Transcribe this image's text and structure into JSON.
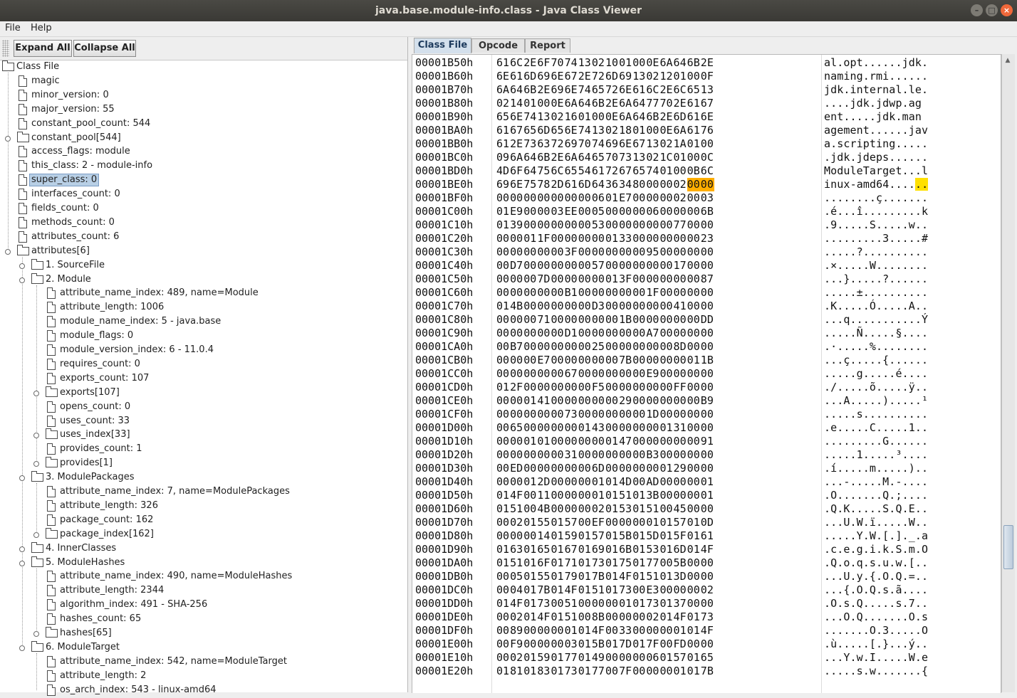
{
  "window": {
    "title": "java.base.module-info.class - Java Class Viewer"
  },
  "menu": {
    "file": "File",
    "help": "Help"
  },
  "toolbar": {
    "expand_all": "Expand All",
    "collapse_all": "Collapse All"
  },
  "tree": {
    "nodes": [
      {
        "label": "Class File",
        "type": "folder",
        "expanded": true,
        "level": 0
      },
      {
        "label": "magic",
        "type": "file",
        "level": 1
      },
      {
        "label": "minor_version: 0",
        "type": "file",
        "level": 1
      },
      {
        "label": "major_version: 55",
        "type": "file",
        "level": 1
      },
      {
        "label": "constant_pool_count: 544",
        "type": "file",
        "level": 1
      },
      {
        "label": "constant_pool[544]",
        "type": "folder",
        "expanded": false,
        "level": 1
      },
      {
        "label": "access_flags: module",
        "type": "file",
        "level": 1
      },
      {
        "label": "this_class: 2 - module-info",
        "type": "file",
        "level": 1
      },
      {
        "label": "super_class: 0",
        "type": "file",
        "level": 1,
        "selected": true
      },
      {
        "label": "interfaces_count: 0",
        "type": "file",
        "level": 1
      },
      {
        "label": "fields_count: 0",
        "type": "file",
        "level": 1
      },
      {
        "label": "methods_count: 0",
        "type": "file",
        "level": 1
      },
      {
        "label": "attributes_count: 6",
        "type": "file",
        "level": 1
      },
      {
        "label": "attributes[6]",
        "type": "folder",
        "expanded": true,
        "level": 1
      },
      {
        "label": "1. SourceFile",
        "type": "folder",
        "expanded": false,
        "level": 2
      },
      {
        "label": "2. Module",
        "type": "folder",
        "expanded": true,
        "level": 2
      },
      {
        "label": "attribute_name_index: 489, name=Module",
        "type": "file",
        "level": 3
      },
      {
        "label": "attribute_length: 1006",
        "type": "file",
        "level": 3
      },
      {
        "label": "module_name_index: 5 - java.base",
        "type": "file",
        "level": 3
      },
      {
        "label": "module_flags: 0",
        "type": "file",
        "level": 3
      },
      {
        "label": "module_version_index: 6 - 11.0.4",
        "type": "file",
        "level": 3
      },
      {
        "label": "requires_count: 0",
        "type": "file",
        "level": 3
      },
      {
        "label": "exports_count: 107",
        "type": "file",
        "level": 3
      },
      {
        "label": "exports[107]",
        "type": "folder",
        "expanded": false,
        "level": 3
      },
      {
        "label": "opens_count: 0",
        "type": "file",
        "level": 3
      },
      {
        "label": "uses_count: 33",
        "type": "file",
        "level": 3
      },
      {
        "label": "uses_index[33]",
        "type": "folder",
        "expanded": false,
        "level": 3
      },
      {
        "label": "provides_count: 1",
        "type": "file",
        "level": 3
      },
      {
        "label": "provides[1]",
        "type": "folder",
        "expanded": false,
        "level": 3
      },
      {
        "label": "3. ModulePackages",
        "type": "folder",
        "expanded": true,
        "level": 2
      },
      {
        "label": "attribute_name_index: 7, name=ModulePackages",
        "type": "file",
        "level": 3
      },
      {
        "label": "attribute_length: 326",
        "type": "file",
        "level": 3
      },
      {
        "label": "package_count: 162",
        "type": "file",
        "level": 3
      },
      {
        "label": "package_index[162]",
        "type": "folder",
        "expanded": false,
        "level": 3
      },
      {
        "label": "4. InnerClasses",
        "type": "folder",
        "expanded": false,
        "level": 2
      },
      {
        "label": "5. ModuleHashes",
        "type": "folder",
        "expanded": true,
        "level": 2
      },
      {
        "label": "attribute_name_index: 490, name=ModuleHashes",
        "type": "file",
        "level": 3
      },
      {
        "label": "attribute_length: 2344",
        "type": "file",
        "level": 3
      },
      {
        "label": "algorithm_index: 491 - SHA-256",
        "type": "file",
        "level": 3
      },
      {
        "label": "hashes_count: 65",
        "type": "file",
        "level": 3
      },
      {
        "label": "hashes[65]",
        "type": "folder",
        "expanded": false,
        "level": 3
      },
      {
        "label": "6. ModuleTarget",
        "type": "folder",
        "expanded": true,
        "level": 2
      },
      {
        "label": "attribute_name_index: 542, name=ModuleTarget",
        "type": "file",
        "level": 3
      },
      {
        "label": "attribute_length: 2",
        "type": "file",
        "level": 3
      },
      {
        "label": "os_arch_index: 543 - linux-amd64",
        "type": "file",
        "level": 3
      }
    ]
  },
  "tabs": [
    {
      "label": "Class File",
      "active": true
    },
    {
      "label": "Opcode",
      "active": false
    },
    {
      "label": "Report",
      "active": false
    }
  ],
  "hex": {
    "highlight": {
      "row": 9,
      "bytes": [
        14,
        15
      ]
    },
    "rows": [
      {
        "addr": "00001B50h",
        "bytes": "61 6C 2E 6F 70 74 13 02 10 01 00 0E 6A 64 6B 2E",
        "ascii": "al.opt......jdk."
      },
      {
        "addr": "00001B60h",
        "bytes": "6E 61 6D 69 6E 67 2E 72 6D 69 13 02 12 01 00 0F",
        "ascii": "naming.rmi......"
      },
      {
        "addr": "00001B70h",
        "bytes": "6A 64 6B 2E 69 6E 74 65 72 6E 61 6C 2E 6C 65 13",
        "ascii": "jdk.internal.le."
      },
      {
        "addr": "00001B80h",
        "bytes": "02 14 01 00 0E 6A 64 6B 2E 6A 64 77 70 2E 61 67",
        "ascii": "....jdk.jdwp.ag"
      },
      {
        "addr": "00001B90h",
        "bytes": "65 6E 74 13 02 16 01 00 0E 6A 64 6B 2E 6D 61 6E",
        "ascii": "ent.....jdk.man"
      },
      {
        "addr": "00001BA0h",
        "bytes": "61 67 65 6D 65 6E 74 13 02 18 01 00 0E 6A 61 76",
        "ascii": "agement......jav"
      },
      {
        "addr": "00001BB0h",
        "bytes": "61 2E 73 63 72 69 70 74 69 6E 67 13 02 1A 01 00",
        "ascii": "a.scripting....."
      },
      {
        "addr": "00001BC0h",
        "bytes": "09 6A 64 6B 2E 6A 64 65 70 73 13 02 1C 01 00 0C",
        "ascii": ".jdk.jdeps......"
      },
      {
        "addr": "00001BD0h",
        "bytes": "4D 6F 64 75 6C 65 54 61 72 67 65 74 01 00 0B 6C",
        "ascii": "ModuleTarget...l"
      },
      {
        "addr": "00001BE0h",
        "bytes": "69 6E 75 78 2D 61 6D 64 36 34 80 00 00 02 00 00",
        "ascii": "inux-amd64......"
      },
      {
        "addr": "00001BF0h",
        "bytes": "00 00 00 00 00 00 00 06 01 E7 00 00 00 02 00 03",
        "ascii": "........ç......."
      },
      {
        "addr": "00001C00h",
        "bytes": "01 E9 00 00 03 EE 00 05 00 00 00 06 00 00 00 6B",
        "ascii": ".é...î.........k"
      },
      {
        "addr": "00001C10h",
        "bytes": "01 39 00 00 00 00 00 53 00 00 00 00 00 77 00 00",
        "ascii": ".9.....S.....w.."
      },
      {
        "addr": "00001C20h",
        "bytes": "00 00 01 1F 00 00 00 00 01 33 00 00 00 00 00 23",
        "ascii": ".........3.....#"
      },
      {
        "addr": "00001C30h",
        "bytes": "00 00 00 00 00 3F 00 00 00 00 00 95 00 00 00 00",
        "ascii": ".....?.........."
      },
      {
        "addr": "00001C40h",
        "bytes": "00 D7 00 00 00 00 00 57 00 00 00 00 00 17 00 00",
        "ascii": ".×.....W........"
      },
      {
        "addr": "00001C50h",
        "bytes": "00 00 00 7D 00 00 00 00 01 3F 00 00 00 00 00 87",
        "ascii": "...}.....?......"
      },
      {
        "addr": "00001C60h",
        "bytes": "00 00 00 00 00 B1 00 00 00 00 00 1F 00 00 00 00",
        "ascii": ".....±.........."
      },
      {
        "addr": "00001C70h",
        "bytes": "01 4B 00 00 00 00 00 D3 00 00 00 00 00 41 00 00",
        "ascii": ".K.....Ó.....A.."
      },
      {
        "addr": "00001C80h",
        "bytes": "00 00 00 71 00 00 00 00 00 1B 00 00 00 00 00 DD",
        "ascii": "...q...........Ý"
      },
      {
        "addr": "00001C90h",
        "bytes": "00 00 00 00 00 D1 00 00 00 00 00 A7 00 00 00 00",
        "ascii": ".....Ñ.....§...."
      },
      {
        "addr": "00001CA0h",
        "bytes": "00 B7 00 00 00 00 00 25 00 00 00 00 00 8D 00 00",
        "ascii": ".·.....%........"
      },
      {
        "addr": "00001CB0h",
        "bytes": "00 00 00 E7 00 00 00 00 00 7B 00 00 00 00 01 1B",
        "ascii": "...ç.....{......"
      },
      {
        "addr": "00001CC0h",
        "bytes": "00 00 00 00 00 67 00 00 00 00 00 E9 00 00 00 00",
        "ascii": ".....g.....é...."
      },
      {
        "addr": "00001CD0h",
        "bytes": "01 2F 00 00 00 00 00 F5 00 00 00 00 00 FF 00 00",
        "ascii": "./.....õ.....ÿ.."
      },
      {
        "addr": "00001CE0h",
        "bytes": "00 00 01 41 00 00 00 00 00 29 00 00 00 00 00 B9",
        "ascii": "...A.....).....¹"
      },
      {
        "addr": "00001CF0h",
        "bytes": "00 00 00 00 00 73 00 00 00 00 00 1D 00 00 00 00",
        "ascii": ".....s.........."
      },
      {
        "addr": "00001D00h",
        "bytes": "00 65 00 00 00 00 01 43 00 00 00 00 01 31 00 00",
        "ascii": ".e.....C.....1.."
      },
      {
        "addr": "00001D10h",
        "bytes": "00 00 01 01 00 00 00 00 01 47 00 00 00 00 00 91",
        "ascii": ".........G......"
      },
      {
        "addr": "00001D20h",
        "bytes": "00 00 00 00 00 31 00 00 00 00 00 B3 00 00 00 00",
        "ascii": ".....1.....³...."
      },
      {
        "addr": "00001D30h",
        "bytes": "00 ED 00 00 00 00 00 6D 00 00 00 00 01 29 00 00",
        "ascii": ".í.....m.....).."
      },
      {
        "addr": "00001D40h",
        "bytes": "00 00 01 2D 00 00 00 01 01 4D 00 AD 00 00 00 01",
        "ascii": "...-.....M.-...."
      },
      {
        "addr": "00001D50h",
        "bytes": "01 4F 00 11 00 00 00 01 01 51 01 3B 00 00 00 01",
        "ascii": ".O.......Q.;...."
      },
      {
        "addr": "00001D60h",
        "bytes": "01 51 00 4B 00 00 00 02 01 53 01 51 00 45 00 00",
        "ascii": ".Q.K.....S.Q.E.."
      },
      {
        "addr": "00001D70h",
        "bytes": "00 02 01 55 01 57 00 EF 00 00 00 01 01 57 01 0D",
        "ascii": "...U.W.ï.....W.."
      },
      {
        "addr": "00001D80h",
        "bytes": "00 00 00 14 01 59 01 57 01 5B 01 5D 01 5F 01 61",
        "ascii": ".....Y.W.[.]._.a"
      },
      {
        "addr": "00001D90h",
        "bytes": "01 63 01 65 01 67 01 69 01 6B 01 53 01 6D 01 4F",
        "ascii": ".c.e.g.i.k.S.m.O"
      },
      {
        "addr": "00001DA0h",
        "bytes": "01 51 01 6F 01 71 01 73 01 75 01 77 00 5B 00 00",
        "ascii": ".Q.o.q.s.u.w.[.."
      },
      {
        "addr": "00001DB0h",
        "bytes": "00 05 01 55 01 79 01 7B 01 4F 01 51 01 3D 00 00",
        "ascii": "...U.y.{.O.Q.=.."
      },
      {
        "addr": "00001DC0h",
        "bytes": "00 04 01 7B 01 4F 01 51 01 73 00 E3 00 00 00 02",
        "ascii": "...{.O.Q.s.ã...."
      },
      {
        "addr": "00001DD0h",
        "bytes": "01 4F 01 73 00 51 00 00 00 01 01 73 01 37 00 00",
        "ascii": ".O.s.Q.....s.7.."
      },
      {
        "addr": "00001DE0h",
        "bytes": "00 02 01 4F 01 51 00 8B 00 00 00 02 01 4F 01 73",
        "ascii": "...O.Q.......O.s"
      },
      {
        "addr": "00001DF0h",
        "bytes": "00 89 00 00 00 01 01 4F 00 33 00 00 00 01 01 4F",
        "ascii": ".......O.3.....O"
      },
      {
        "addr": "00001E00h",
        "bytes": "00 F9 00 00 00 03 01 5B 01 7D 01 7F 00 FD 00 00",
        "ascii": ".ù.....[.}...ý.."
      },
      {
        "addr": "00001E10h",
        "bytes": "00 02 01 59 01 77 01 49 00 00 00 06 01 57 01 65",
        "ascii": "...Y.w.I.....W.e"
      },
      {
        "addr": "00001E20h",
        "bytes": "01 81 01 83 01 73 01 77 00 7F 00 00 00 01 01 7B",
        "ascii": ".....s.w.......{"
      }
    ]
  }
}
